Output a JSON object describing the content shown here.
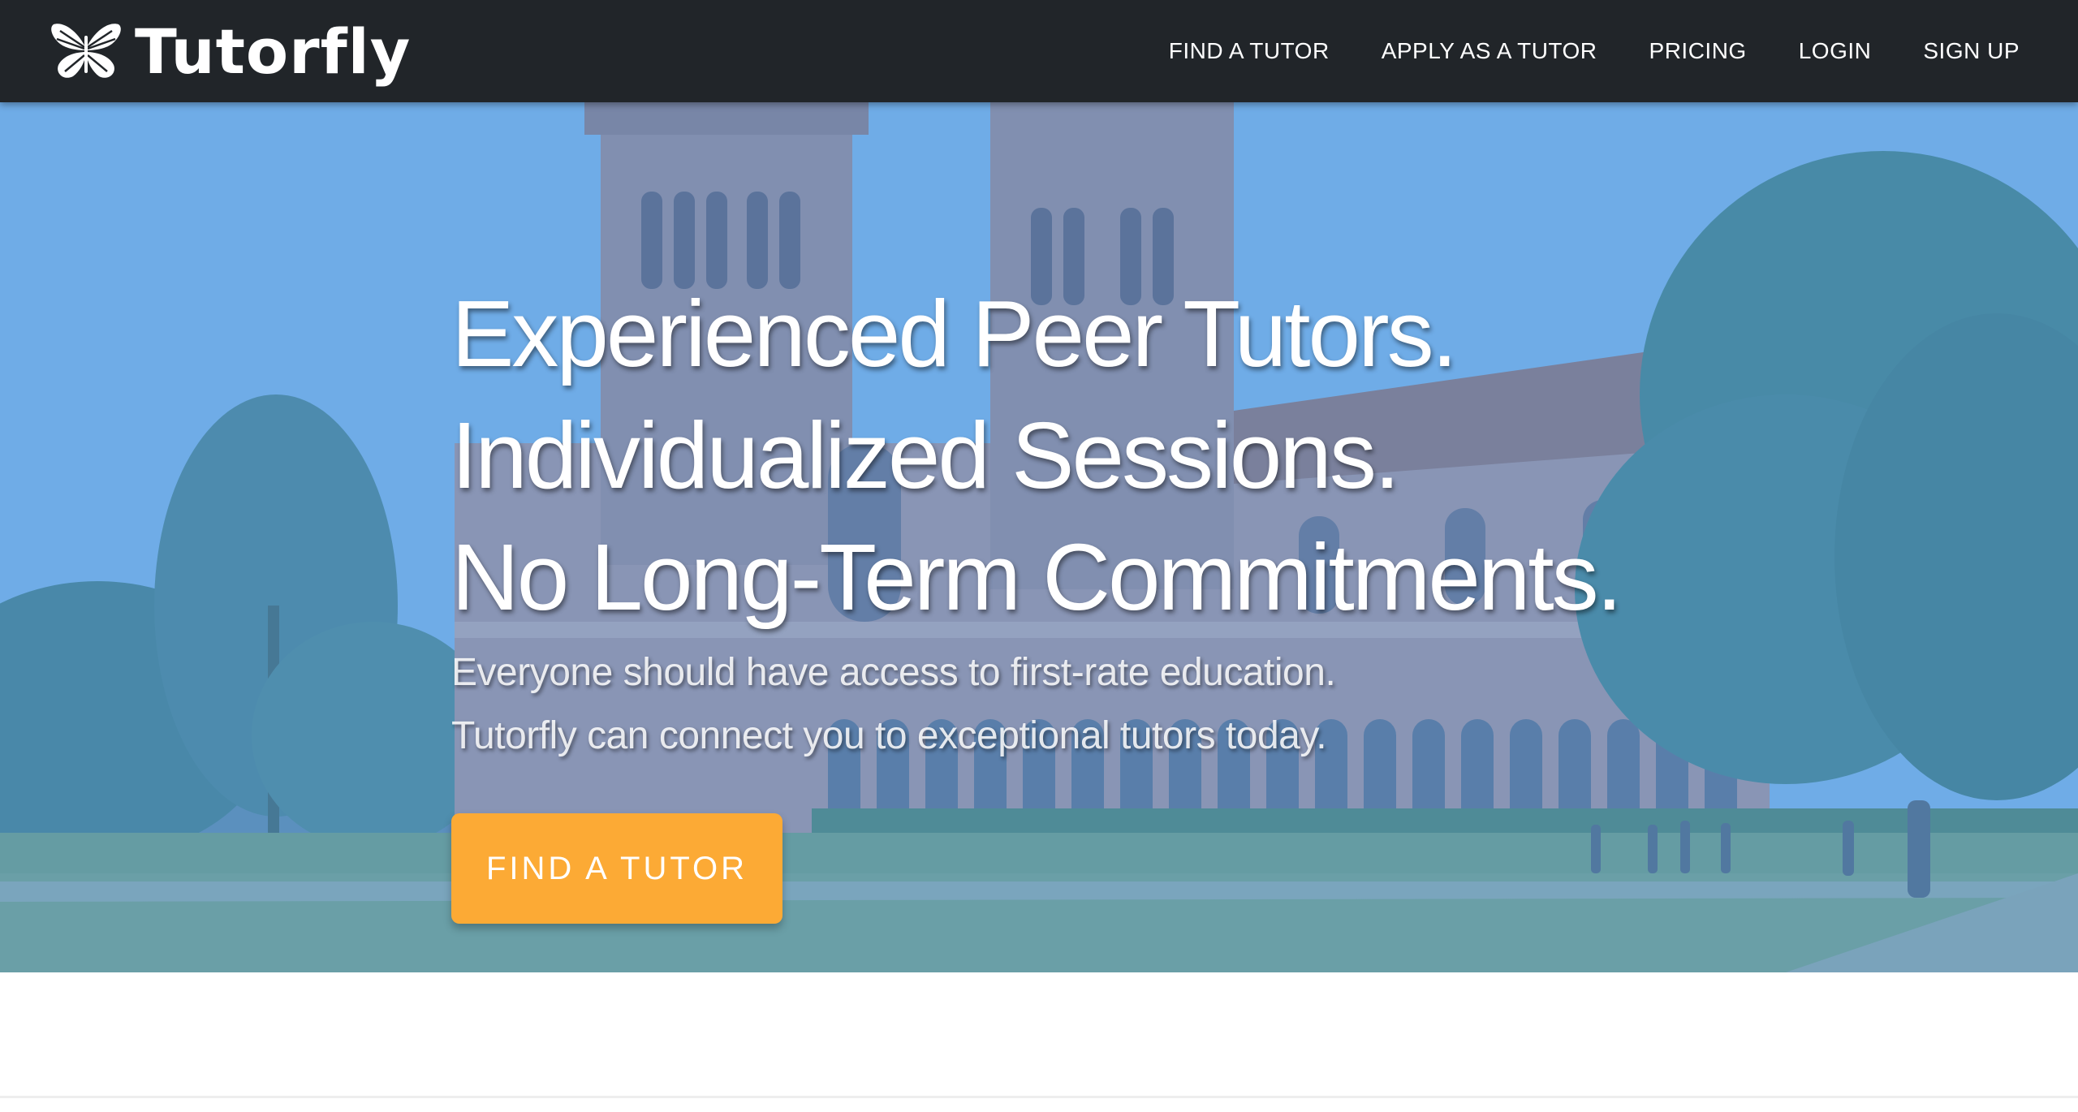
{
  "brand": {
    "name": "Tutorfly",
    "icon": "butterfly-logo-icon"
  },
  "nav": {
    "items": [
      {
        "label": "FIND A TUTOR"
      },
      {
        "label": "APPLY AS A TUTOR"
      },
      {
        "label": "PRICING"
      },
      {
        "label": "LOGIN"
      },
      {
        "label": "SIGN UP"
      }
    ]
  },
  "hero": {
    "headlines": [
      "Experienced Peer Tutors.",
      "Individualized Sessions.",
      "No Long-Term Commitments."
    ],
    "sublines": [
      "Everyone should have access to first-rate education.",
      "Tutorfly can connect you to exceptional tutors today."
    ],
    "cta_label": "FIND A TUTOR"
  },
  "colors": {
    "navbar": "#212529",
    "cta": "#fcaa35",
    "hero_tint": "#5aa0e1"
  }
}
